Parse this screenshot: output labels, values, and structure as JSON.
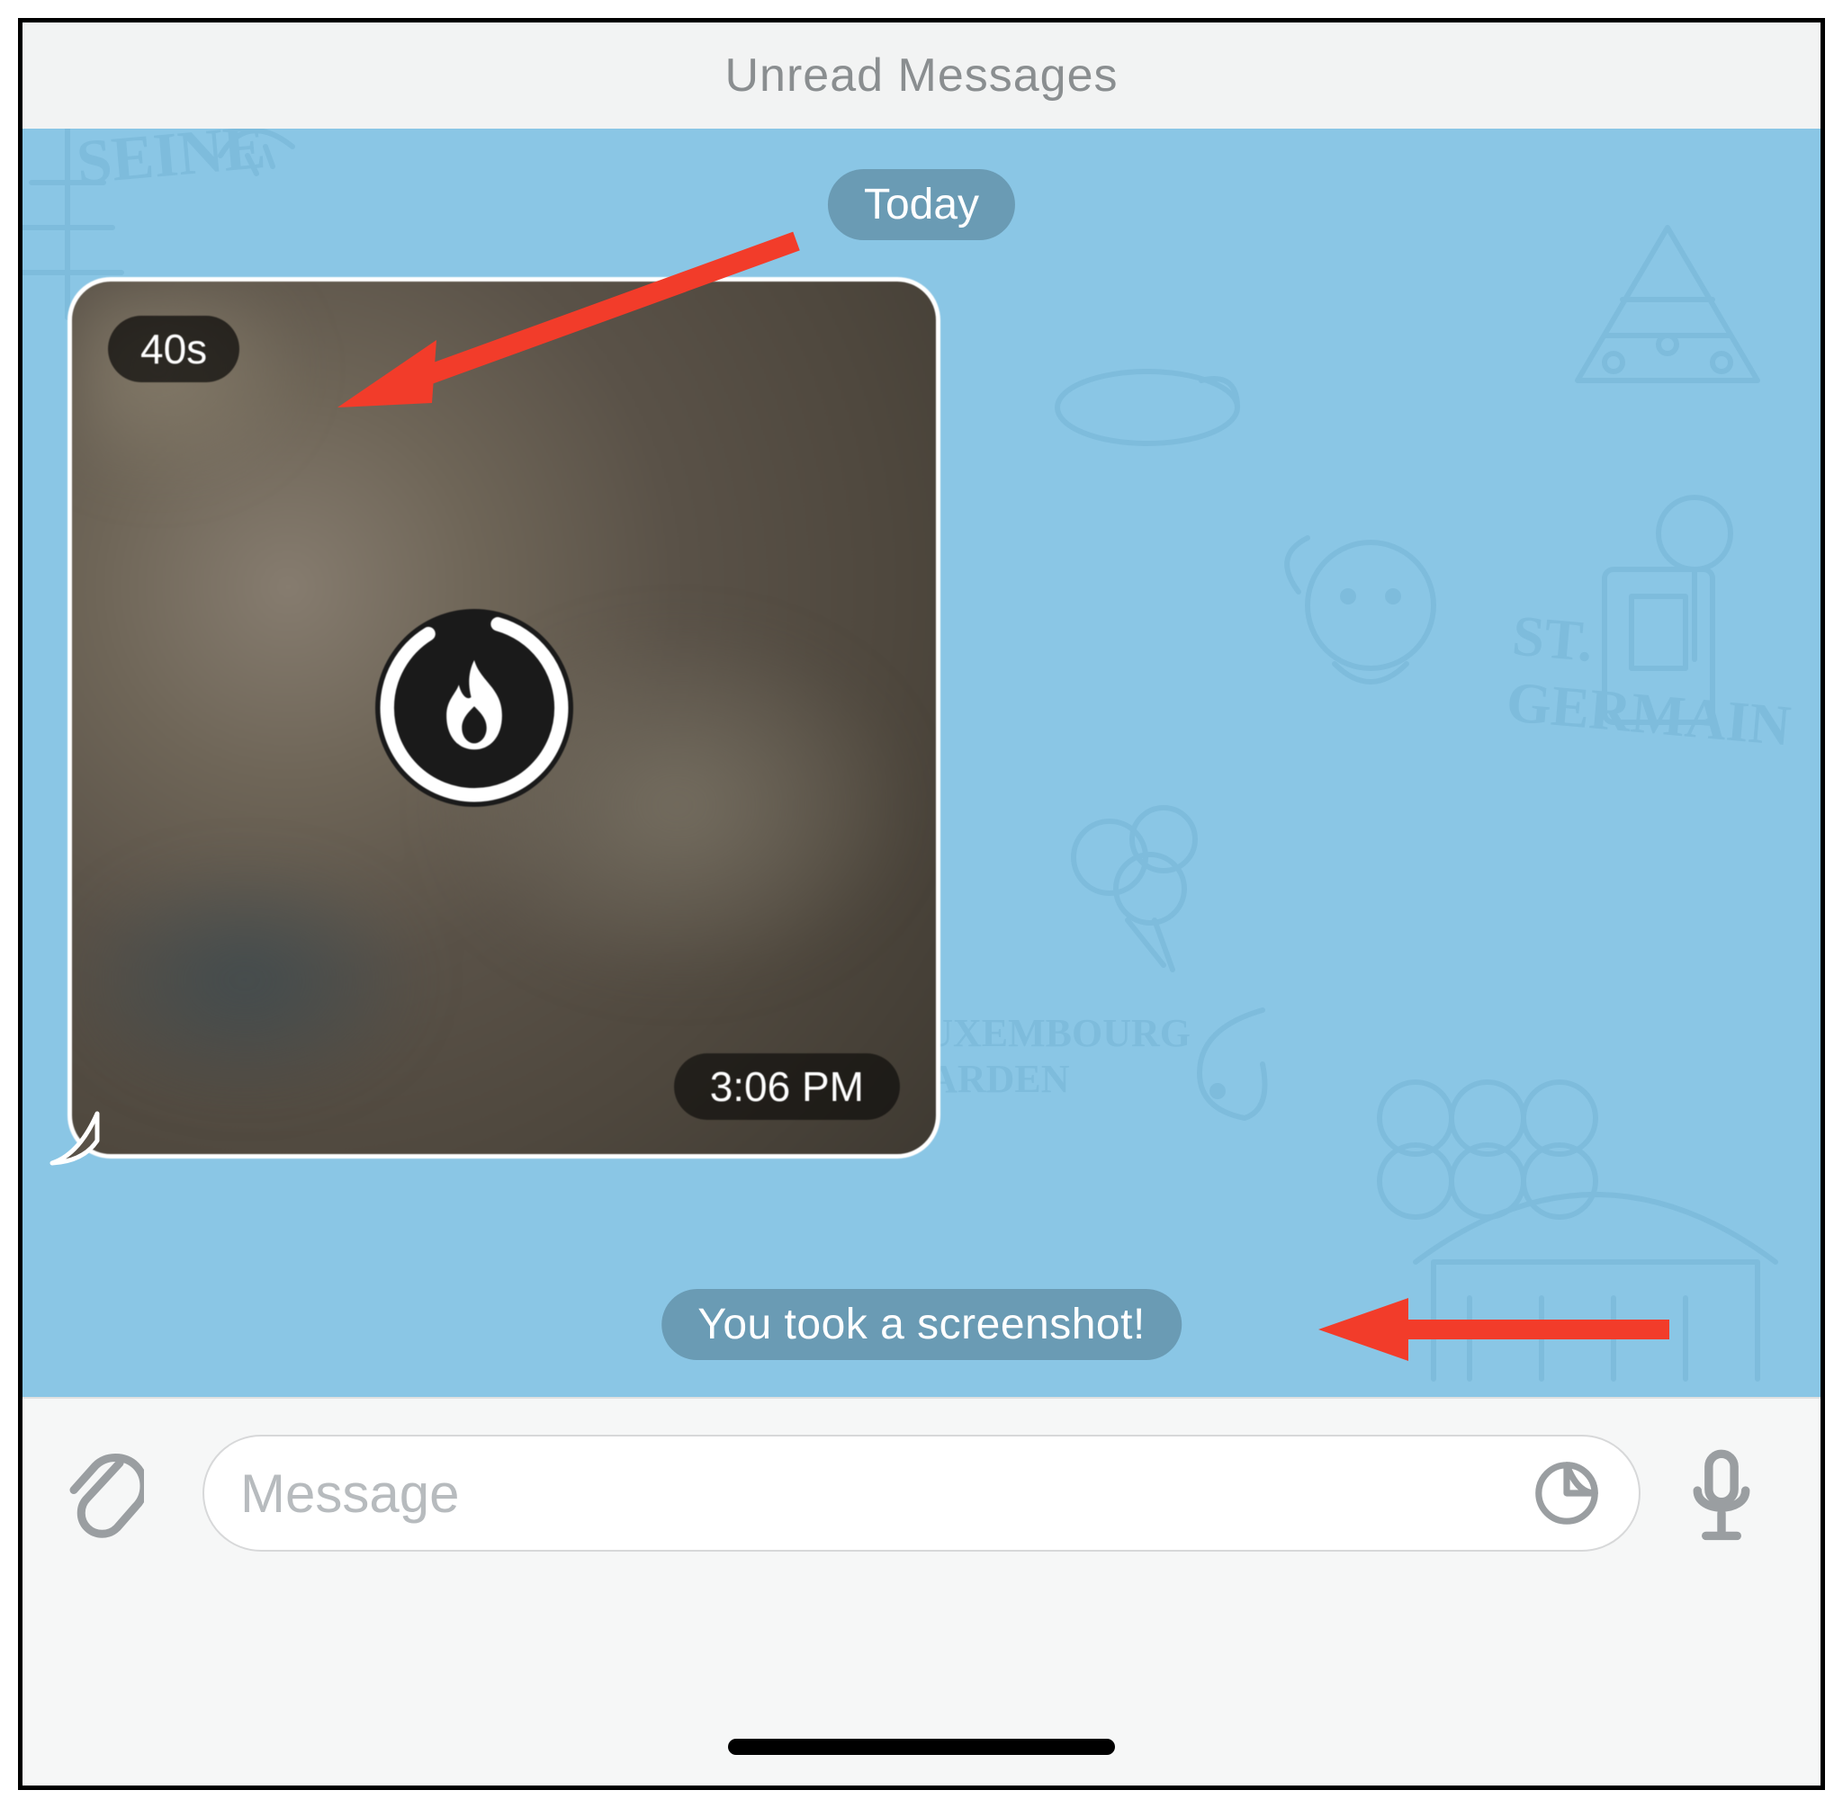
{
  "header": {
    "unread_label": "Unread Messages"
  },
  "chat": {
    "date_label": "Today",
    "media": {
      "self_destruct_timer": "40s",
      "timestamp": "3:06 PM",
      "icon_name": "flame-icon"
    },
    "system_message": "You took a screenshot!"
  },
  "composer": {
    "placeholder": "Message"
  },
  "annotations": {
    "arrow1_target": "self-destruct-timer-badge",
    "arrow2_target": "system-message-pill"
  },
  "colors": {
    "chat_bg": "#8ac6e5",
    "pill_bg": "rgba(80,120,140,0.55)",
    "arrow": "#f23c2a",
    "icon_gray": "#9a9ea1"
  }
}
